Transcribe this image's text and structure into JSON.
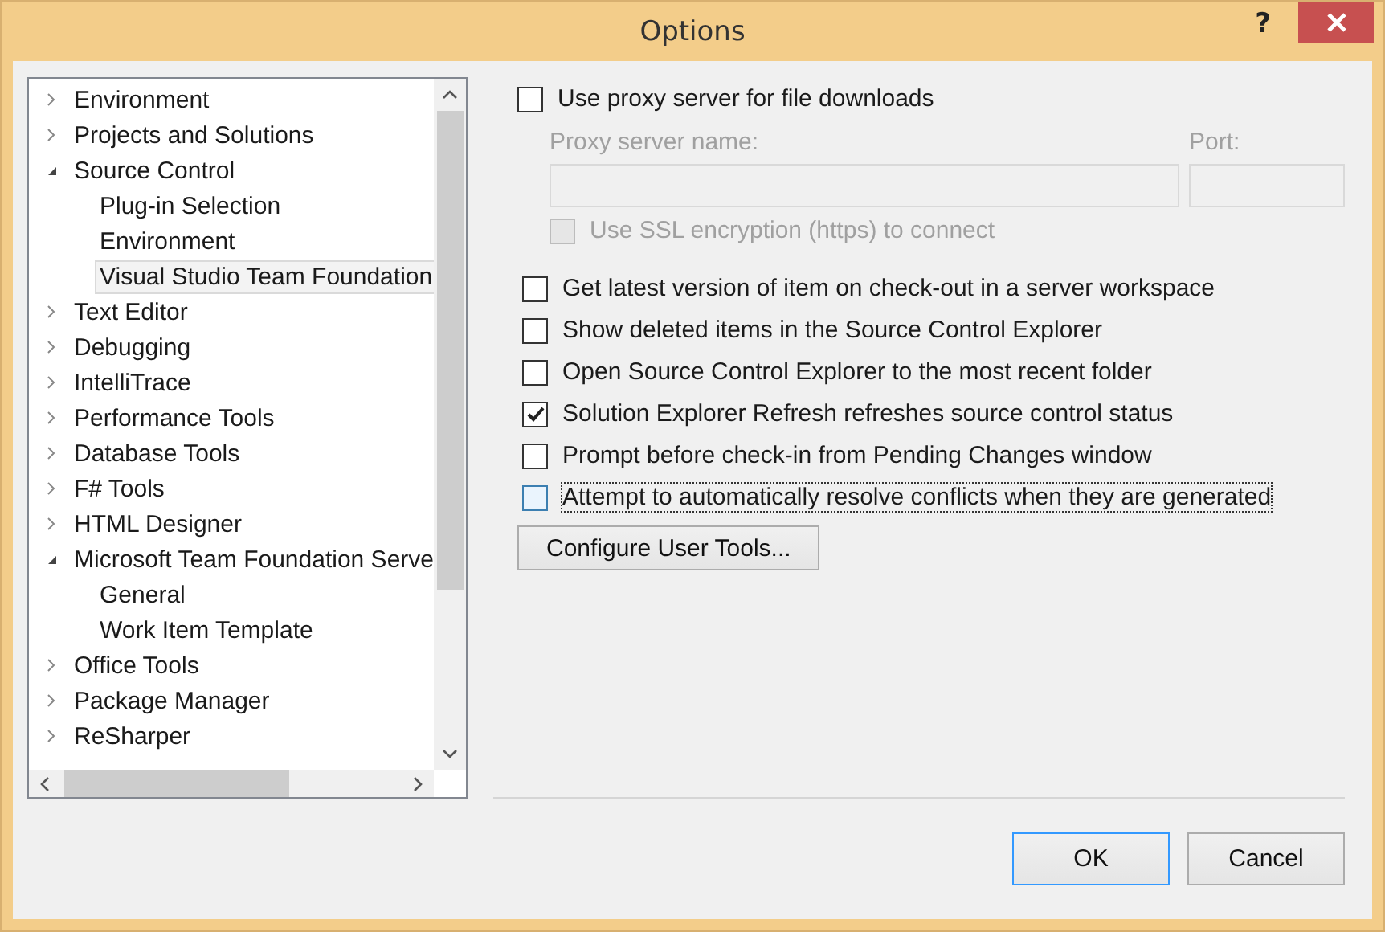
{
  "window": {
    "title": "Options",
    "help_label": "?"
  },
  "tree": {
    "items": [
      {
        "label": "Environment",
        "expanded": false,
        "selected": false
      },
      {
        "label": "Projects and Solutions",
        "expanded": false,
        "selected": false
      },
      {
        "label": "Source Control",
        "expanded": true,
        "selected": false,
        "children": [
          {
            "label": "Plug-in Selection",
            "selected": false
          },
          {
            "label": "Environment",
            "selected": false
          },
          {
            "label": "Visual Studio Team Foundation",
            "selected": true
          }
        ]
      },
      {
        "label": "Text Editor",
        "expanded": false,
        "selected": false
      },
      {
        "label": "Debugging",
        "expanded": false,
        "selected": false
      },
      {
        "label": "IntelliTrace",
        "expanded": false,
        "selected": false
      },
      {
        "label": "Performance Tools",
        "expanded": false,
        "selected": false
      },
      {
        "label": "Database Tools",
        "expanded": false,
        "selected": false
      },
      {
        "label": "F# Tools",
        "expanded": false,
        "selected": false
      },
      {
        "label": "HTML Designer",
        "expanded": false,
        "selected": false
      },
      {
        "label": "Microsoft Team Foundation Serve",
        "expanded": true,
        "selected": false,
        "children": [
          {
            "label": "General",
            "selected": false
          },
          {
            "label": "Work Item Template",
            "selected": false
          }
        ]
      },
      {
        "label": "Office Tools",
        "expanded": false,
        "selected": false
      },
      {
        "label": "Package Manager",
        "expanded": false,
        "selected": false
      },
      {
        "label": "ReSharper",
        "expanded": false,
        "selected": false
      }
    ]
  },
  "proxy": {
    "label": "Use proxy server for file downloads",
    "checked": false,
    "server_label": "Proxy server name:",
    "port_label": "Port:",
    "ssl": {
      "label": "Use SSL encryption (https) to connect",
      "checked": false,
      "disabled": true
    }
  },
  "options": [
    {
      "label": "Get latest version of item on check-out in a server workspace",
      "checked": false,
      "focused": false
    },
    {
      "label": "Show deleted items in the Source Control Explorer",
      "checked": false,
      "focused": false
    },
    {
      "label": "Open Source Control Explorer to the most recent folder",
      "checked": false,
      "focused": false
    },
    {
      "label": "Solution Explorer Refresh refreshes source control status",
      "checked": true,
      "focused": false
    },
    {
      "label": "Prompt before check-in from Pending Changes window",
      "checked": false,
      "focused": false
    },
    {
      "label": "Attempt to automatically resolve conflicts when they are generated",
      "checked": false,
      "focused": true
    }
  ],
  "configure_button": "Configure User Tools...",
  "buttons": [
    {
      "label": "OK",
      "default": true
    },
    {
      "label": "Cancel",
      "default": false
    }
  ]
}
